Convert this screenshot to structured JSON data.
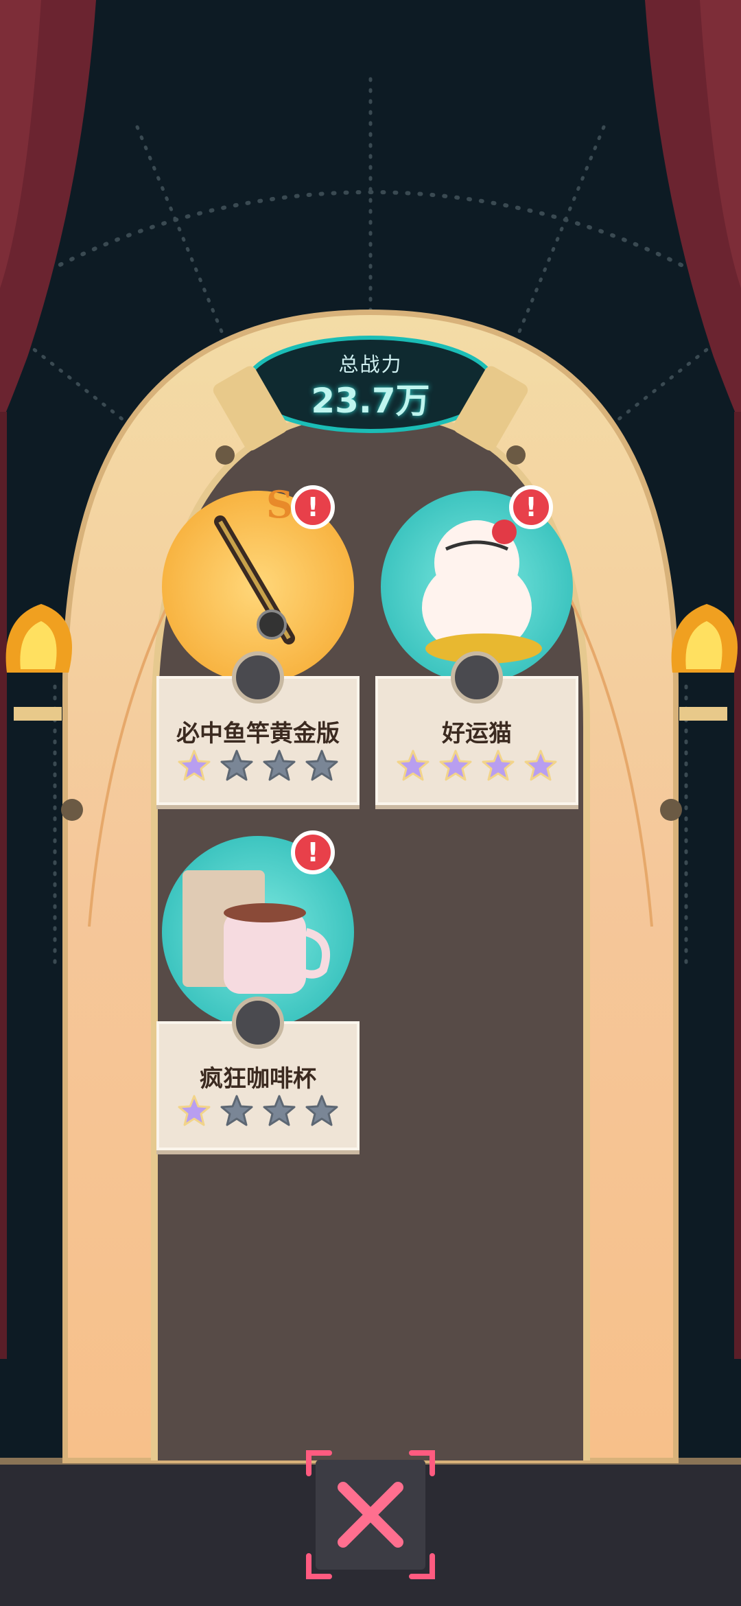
{
  "header": {
    "power_label": "总战力",
    "power_value": "23.7万"
  },
  "items": [
    {
      "name": "必中鱼竿黄金版",
      "stars_filled": 1,
      "stars_total": 4,
      "badge": "!",
      "grade": "SS",
      "circle_color": "#f7b83a",
      "icon": "fishing-rod-icon"
    },
    {
      "name": "好运猫",
      "stars_filled": 4,
      "stars_total": 4,
      "badge": "!",
      "circle_color": "#2ec4c2",
      "icon": "lucky-cat-icon"
    },
    {
      "name": "疯狂咖啡杯",
      "stars_filled": 1,
      "stars_total": 4,
      "badge": "!",
      "circle_color": "#2ec4c2",
      "icon": "coffee-cup-icon"
    }
  ],
  "footer": {
    "close_icon": "close-icon"
  },
  "colors": {
    "background": "#0d1b24",
    "curtain": "#6b2430",
    "arch_gold": "#e8c98a",
    "panel": "#574b47",
    "badge_red": "#e8404a",
    "close_pink": "#ff5b80"
  }
}
